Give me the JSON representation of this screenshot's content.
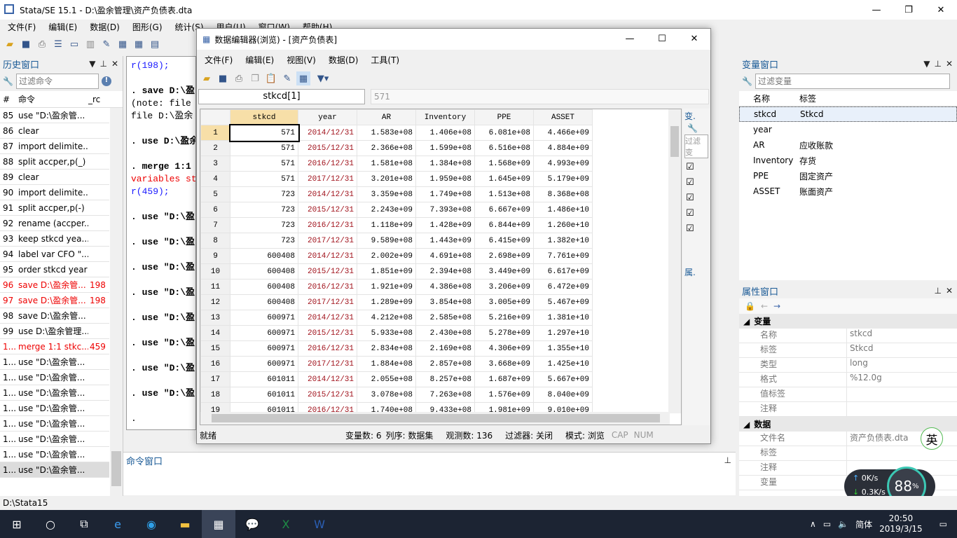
{
  "app": {
    "title": "Stata/SE 15.1 - D:\\盈余管理\\资产负债表.dta"
  },
  "menu": [
    "文件(F)",
    "编辑(E)",
    "数据(D)",
    "图形(G)",
    "统计(S)",
    "用户(U)",
    "窗口(W)",
    "帮助(H)"
  ],
  "history": {
    "title": "历史窗口",
    "filter_placeholder": "过滤命令",
    "col_num": "#",
    "col_cmd": "命令",
    "col_rc": "_rc",
    "rows": [
      {
        "n": "85",
        "c": "use \"D:\\盈余管...",
        "rc": "",
        "err": false
      },
      {
        "n": "86",
        "c": "clear",
        "rc": "",
        "err": false
      },
      {
        "n": "87",
        "c": "import delimite...",
        "rc": "",
        "err": false
      },
      {
        "n": "88",
        "c": "split accper,p(_)",
        "rc": "",
        "err": false
      },
      {
        "n": "89",
        "c": "clear",
        "rc": "",
        "err": false
      },
      {
        "n": "90",
        "c": "import delimite...",
        "rc": "",
        "err": false
      },
      {
        "n": "91",
        "c": "split accper,p(-)",
        "rc": "",
        "err": false
      },
      {
        "n": "92",
        "c": "rename (accper...",
        "rc": "",
        "err": false
      },
      {
        "n": "93",
        "c": "keep stkcd yea...",
        "rc": "",
        "err": false
      },
      {
        "n": "94",
        "c": "label var CFO \"...",
        "rc": "",
        "err": false
      },
      {
        "n": "95",
        "c": "order stkcd year",
        "rc": "",
        "err": false
      },
      {
        "n": "96",
        "c": "save D:\\盈余管...",
        "rc": "198",
        "err": true
      },
      {
        "n": "97",
        "c": " save D:\\盈余管...",
        "rc": "198",
        "err": true
      },
      {
        "n": "98",
        "c": "save D:\\盈余管...",
        "rc": "",
        "err": false
      },
      {
        "n": "99",
        "c": "use D:\\盈余管理...",
        "rc": "",
        "err": false
      },
      {
        "n": "1...",
        "c": "merge 1:1 stkc...",
        "rc": "459",
        "err": true
      },
      {
        "n": "1...",
        "c": "use \"D:\\盈余管...",
        "rc": "",
        "err": false
      },
      {
        "n": "1...",
        "c": "use \"D:\\盈余管...",
        "rc": "",
        "err": false
      },
      {
        "n": "1...",
        "c": "use \"D:\\盈余管...",
        "rc": "",
        "err": false
      },
      {
        "n": "1...",
        "c": "use \"D:\\盈余管...",
        "rc": "",
        "err": false
      },
      {
        "n": "1...",
        "c": "use \"D:\\盈余管...",
        "rc": "",
        "err": false
      },
      {
        "n": "1...",
        "c": "use \"D:\\盈余管...",
        "rc": "",
        "err": false
      },
      {
        "n": "1...",
        "c": "use \"D:\\盈余管...",
        "rc": "",
        "err": false
      },
      {
        "n": "1...",
        "c": "use \"D:\\盈余管...",
        "rc": "",
        "err": false
      }
    ]
  },
  "results": {
    "lines": [
      {
        "t": "r(198);",
        "cls": "blue"
      },
      {
        "t": "",
        "cls": ""
      },
      {
        "t": ". save D:\\盈",
        "cls": "bold"
      },
      {
        "t": "(note: file ",
        "cls": ""
      },
      {
        "t": "file D:\\盈余",
        "cls": ""
      },
      {
        "t": "",
        "cls": ""
      },
      {
        "t": ". use D:\\盈余",
        "cls": "bold"
      },
      {
        "t": "",
        "cls": ""
      },
      {
        "t": ". merge 1:1 ",
        "cls": "bold"
      },
      {
        "t": "variables st",
        "cls": "red"
      },
      {
        "t": "r(459);",
        "cls": "blue"
      },
      {
        "t": "",
        "cls": ""
      },
      {
        "t": ". use \"D:\\盈",
        "cls": "bold"
      },
      {
        "t": "",
        "cls": ""
      },
      {
        "t": ". use \"D:\\盈",
        "cls": "bold"
      },
      {
        "t": "",
        "cls": ""
      },
      {
        "t": ". use \"D:\\盈",
        "cls": "bold"
      },
      {
        "t": "",
        "cls": ""
      },
      {
        "t": ". use \"D:\\盈",
        "cls": "bold"
      },
      {
        "t": "",
        "cls": ""
      },
      {
        "t": ". use \"D:\\盈",
        "cls": "bold"
      },
      {
        "t": "",
        "cls": ""
      },
      {
        "t": ". use \"D:\\盈",
        "cls": "bold"
      },
      {
        "t": "",
        "cls": ""
      },
      {
        "t": ". use \"D:\\盈",
        "cls": "bold"
      },
      {
        "t": "",
        "cls": ""
      },
      {
        "t": ". use \"D:\\盈",
        "cls": "bold"
      },
      {
        "t": "",
        "cls": ""
      },
      {
        "t": ".",
        "cls": ""
      }
    ]
  },
  "command": {
    "title": "命令窗口"
  },
  "editor": {
    "title": "数据编辑器(浏览) - [资产负债表]",
    "menu": [
      "文件(F)",
      "编辑(E)",
      "视图(V)",
      "数据(D)",
      "工具(T)"
    ],
    "cell_ref": "stkcd[1]",
    "cell_value": "571",
    "columns": [
      "stkcd",
      "year",
      "AR",
      "Inventory",
      "PPE",
      "ASSET"
    ],
    "rows": [
      [
        "571",
        "2014/12/31",
        "1.583e+08",
        "1.406e+08",
        "6.081e+08",
        "4.466e+09"
      ],
      [
        "571",
        "2015/12/31",
        "2.366e+08",
        "1.599e+08",
        "6.516e+08",
        "4.884e+09"
      ],
      [
        "571",
        "2016/12/31",
        "1.581e+08",
        "1.384e+08",
        "1.568e+09",
        "4.993e+09"
      ],
      [
        "571",
        "2017/12/31",
        "3.201e+08",
        "1.959e+08",
        "1.645e+09",
        "5.179e+09"
      ],
      [
        "723",
        "2014/12/31",
        "3.359e+08",
        "1.749e+08",
        "1.513e+08",
        "8.368e+08"
      ],
      [
        "723",
        "2015/12/31",
        "2.243e+09",
        "7.393e+08",
        "6.667e+09",
        "1.486e+10"
      ],
      [
        "723",
        "2016/12/31",
        "1.118e+09",
        "1.428e+09",
        "6.844e+09",
        "1.260e+10"
      ],
      [
        "723",
        "2017/12/31",
        "9.589e+08",
        "1.443e+09",
        "6.415e+09",
        "1.382e+10"
      ],
      [
        "600408",
        "2014/12/31",
        "2.002e+09",
        "4.691e+08",
        "2.698e+09",
        "7.761e+09"
      ],
      [
        "600408",
        "2015/12/31",
        "1.851e+09",
        "2.394e+08",
        "3.449e+09",
        "6.617e+09"
      ],
      [
        "600408",
        "2016/12/31",
        "1.921e+09",
        "4.386e+08",
        "3.206e+09",
        "6.472e+09"
      ],
      [
        "600408",
        "2017/12/31",
        "1.289e+09",
        "3.854e+08",
        "3.005e+09",
        "5.467e+09"
      ],
      [
        "600971",
        "2014/12/31",
        "4.212e+08",
        "2.585e+08",
        "5.216e+09",
        "1.381e+10"
      ],
      [
        "600971",
        "2015/12/31",
        "5.933e+08",
        "2.430e+08",
        "5.278e+09",
        "1.297e+10"
      ],
      [
        "600971",
        "2016/12/31",
        "2.834e+08",
        "2.169e+08",
        "4.306e+09",
        "1.355e+10"
      ],
      [
        "600971",
        "2017/12/31",
        "1.884e+08",
        "2.857e+08",
        "3.668e+09",
        "1.425e+10"
      ],
      [
        "601011",
        "2014/12/31",
        "2.055e+08",
        "8.257e+08",
        "1.687e+09",
        "5.667e+09"
      ],
      [
        "601011",
        "2015/12/31",
        "3.078e+08",
        "7.263e+08",
        "1.576e+09",
        "8.040e+09"
      ],
      [
        "601011",
        "2016/12/31",
        "1.740e+08",
        "9.433e+08",
        "1.981e+09",
        "9.010e+09"
      ]
    ],
    "side_var_label": "变.",
    "side_filter": "过滤变",
    "side_prop_label": "属.",
    "status": {
      "ready": "就绪",
      "vars": "变量数: 6",
      "order": "列序: 数据集",
      "obs": "观测数: 136",
      "filter": "过滤器: 关闭",
      "mode": "模式: 浏览",
      "cap": "CAP",
      "num": "NUM"
    }
  },
  "variables": {
    "title": "变量窗口",
    "filter_placeholder": "过滤变量",
    "col_name": "名称",
    "col_label": "标签",
    "rows": [
      {
        "name": "stkcd",
        "label": "Stkcd"
      },
      {
        "name": "year",
        "label": ""
      },
      {
        "name": "AR",
        "label": "应收账款"
      },
      {
        "name": "Inventory",
        "label": "存货"
      },
      {
        "name": "PPE",
        "label": "固定资产"
      },
      {
        "name": "ASSET",
        "label": "账面资产"
      }
    ]
  },
  "properties": {
    "title": "属性窗口",
    "sec_var": "变量",
    "sec_data": "数据",
    "var_rows": [
      {
        "k": "名称",
        "v": "stkcd"
      },
      {
        "k": "标签",
        "v": "Stkcd"
      },
      {
        "k": "类型",
        "v": "long"
      },
      {
        "k": "格式",
        "v": "%12.0g"
      },
      {
        "k": "值标签",
        "v": ""
      },
      {
        "k": "注释",
        "v": ""
      }
    ],
    "data_rows": [
      {
        "k": "文件名",
        "v": "资产负债表.dta"
      },
      {
        "k": "标签",
        "v": ""
      },
      {
        "k": "注释",
        "v": ""
      },
      {
        "k": "变量",
        "v": ""
      }
    ]
  },
  "statusbar": {
    "path": "D:\\Stata15"
  },
  "overlay": {
    "up": "0K/s",
    "down": "0.3K/s",
    "percent": "88",
    "ime": "英"
  },
  "taskbar": {
    "time": "20:50",
    "date": "2019/3/15",
    "lang": "简体"
  }
}
